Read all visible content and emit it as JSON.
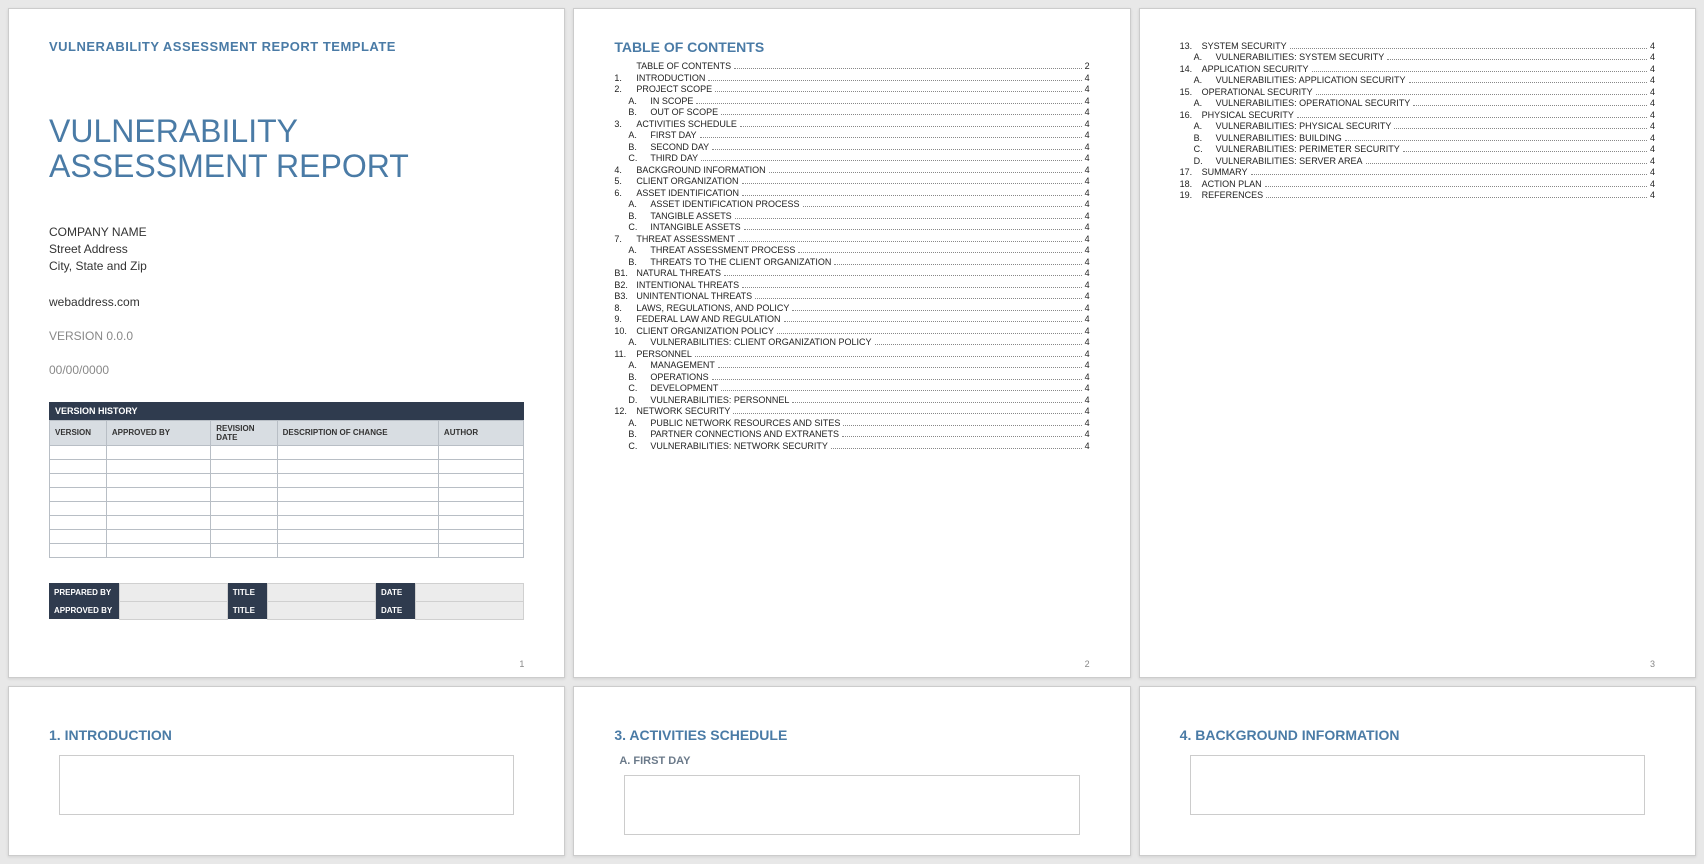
{
  "page1": {
    "template_label": "VULNERABILITY ASSESSMENT REPORT TEMPLATE",
    "title_line1": "VULNERABILITY",
    "title_line2": "ASSESSMENT REPORT",
    "company": "COMPANY NAME",
    "street": "Street Address",
    "citystate": "City, State and Zip",
    "web": "webaddress.com",
    "version": "VERSION 0.0.0",
    "date": "00/00/0000",
    "vh_header": "VERSION HISTORY",
    "vh_cols": {
      "c1": "VERSION",
      "c2": "APPROVED BY",
      "c3": "REVISION DATE",
      "c4": "DESCRIPTION OF CHANGE",
      "c5": "AUTHOR"
    },
    "signoff": {
      "prepared": "PREPARED BY",
      "approved": "APPROVED BY",
      "title": "TITLE",
      "date": "DATE"
    },
    "pagenum": "1"
  },
  "toc": {
    "heading": "TABLE OF CONTENTS",
    "page2num": "2",
    "page3num": "3",
    "p2": [
      {
        "n": "",
        "l": "TABLE OF CONTENTS",
        "p": "2",
        "i": 0
      },
      {
        "n": "1.",
        "l": "INTRODUCTION",
        "p": "4",
        "i": 0
      },
      {
        "n": "2.",
        "l": "PROJECT SCOPE",
        "p": "4",
        "i": 0
      },
      {
        "n": "A.",
        "l": "IN SCOPE",
        "p": "4",
        "i": 1
      },
      {
        "n": "B.",
        "l": "OUT OF SCOPE",
        "p": "4",
        "i": 1
      },
      {
        "n": "3.",
        "l": "ACTIVITIES SCHEDULE",
        "p": "4",
        "i": 0
      },
      {
        "n": "A.",
        "l": "FIRST DAY",
        "p": "4",
        "i": 1
      },
      {
        "n": "B.",
        "l": "SECOND DAY",
        "p": "4",
        "i": 1
      },
      {
        "n": "C.",
        "l": "THIRD DAY",
        "p": "4",
        "i": 1
      },
      {
        "n": "4.",
        "l": "BACKGROUND INFORMATION",
        "p": "4",
        "i": 0
      },
      {
        "n": "5.",
        "l": "CLIENT ORGANIZATION",
        "p": "4",
        "i": 0
      },
      {
        "n": "6.",
        "l": "ASSET IDENTIFICATION",
        "p": "4",
        "i": 0
      },
      {
        "n": "A.",
        "l": "ASSET IDENTIFICATION PROCESS",
        "p": "4",
        "i": 1
      },
      {
        "n": "B.",
        "l": "TANGIBLE ASSETS",
        "p": "4",
        "i": 1
      },
      {
        "n": "C.",
        "l": "INTANGIBLE ASSETS",
        "p": "4",
        "i": 1
      },
      {
        "n": "7.",
        "l": "THREAT ASSESSMENT",
        "p": "4",
        "i": 0
      },
      {
        "n": "A.",
        "l": "THREAT ASSESSMENT PROCESS",
        "p": "4",
        "i": 1
      },
      {
        "n": "B.",
        "l": "THREATS TO THE CLIENT ORGANIZATION",
        "p": "4",
        "i": 1
      },
      {
        "n": "B1.",
        "l": "NATURAL THREATS",
        "p": "4",
        "i": 0
      },
      {
        "n": "B2.",
        "l": "INTENTIONAL THREATS",
        "p": "4",
        "i": 0
      },
      {
        "n": "B3.",
        "l": "UNINTENTIONAL THREATS",
        "p": "4",
        "i": 0
      },
      {
        "n": "8.",
        "l": "LAWS, REGULATIONS, AND POLICY",
        "p": "4",
        "i": 0
      },
      {
        "n": "9.",
        "l": "FEDERAL LAW AND REGULATION",
        "p": "4",
        "i": 0
      },
      {
        "n": "10.",
        "l": "CLIENT ORGANIZATION POLICY",
        "p": "4",
        "i": 0
      },
      {
        "n": "A.",
        "l": "VULNERABILITIES: CLIENT ORGANIZATION POLICY",
        "p": "4",
        "i": 1
      },
      {
        "n": "11.",
        "l": "PERSONNEL",
        "p": "4",
        "i": 0
      },
      {
        "n": "A.",
        "l": "MANAGEMENT",
        "p": "4",
        "i": 1
      },
      {
        "n": "B.",
        "l": "OPERATIONS",
        "p": "4",
        "i": 1
      },
      {
        "n": "C.",
        "l": "DEVELOPMENT",
        "p": "4",
        "i": 1
      },
      {
        "n": "D.",
        "l": "VULNERABILITIES: PERSONNEL",
        "p": "4",
        "i": 1
      },
      {
        "n": "12.",
        "l": "NETWORK SECURITY",
        "p": "4",
        "i": 0
      },
      {
        "n": "A.",
        "l": "PUBLIC NETWORK RESOURCES AND SITES",
        "p": "4",
        "i": 1
      },
      {
        "n": "B.",
        "l": "PARTNER CONNECTIONS AND EXTRANETS",
        "p": "4",
        "i": 1
      },
      {
        "n": "C.",
        "l": "VULNERABILITIES: NETWORK SECURITY",
        "p": "4",
        "i": 1
      }
    ],
    "p3": [
      {
        "n": "13.",
        "l": "SYSTEM SECURITY",
        "p": "4",
        "i": 0
      },
      {
        "n": "A.",
        "l": "VULNERABILITIES: SYSTEM SECURITY",
        "p": "4",
        "i": 1
      },
      {
        "n": "14.",
        "l": "APPLICATION SECURITY",
        "p": "4",
        "i": 0
      },
      {
        "n": "A.",
        "l": "VULNERABILITIES: APPLICATION SECURITY",
        "p": "4",
        "i": 1
      },
      {
        "n": "15.",
        "l": "OPERATIONAL SECURITY",
        "p": "4",
        "i": 0
      },
      {
        "n": "A.",
        "l": "VULNERABILITIES: OPERATIONAL SECURITY",
        "p": "4",
        "i": 1
      },
      {
        "n": "16.",
        "l": "PHYSICAL SECURITY",
        "p": "4",
        "i": 0
      },
      {
        "n": "A.",
        "l": "VULNERABILITIES: PHYSICAL SECURITY",
        "p": "4",
        "i": 1
      },
      {
        "n": "B.",
        "l": "VULNERABILITIES: BUILDING",
        "p": "4",
        "i": 1
      },
      {
        "n": "C.",
        "l": "VULNERABILITIES: PERIMETER SECURITY",
        "p": "4",
        "i": 1
      },
      {
        "n": "D.",
        "l": "VULNERABILITIES: SERVER AREA",
        "p": "4",
        "i": 1
      },
      {
        "n": "17.",
        "l": "SUMMARY",
        "p": "4",
        "i": 0
      },
      {
        "n": "18.",
        "l": "ACTION PLAN",
        "p": "4",
        "i": 0
      },
      {
        "n": "19.",
        "l": "REFERENCES",
        "p": "4",
        "i": 0
      }
    ]
  },
  "sections": {
    "s1": "1. INTRODUCTION",
    "s3": "3. ACTIVITIES SCHEDULE",
    "s3a": "A. FIRST DAY",
    "s4": "4. BACKGROUND INFORMATION"
  }
}
